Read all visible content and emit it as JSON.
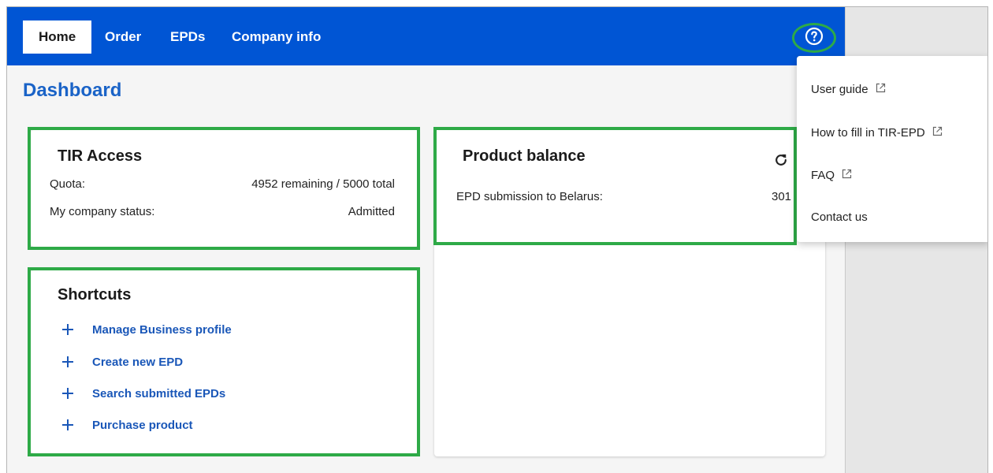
{
  "nav": {
    "tabs": [
      {
        "label": "Home"
      },
      {
        "label": "Order"
      },
      {
        "label": "EPDs"
      },
      {
        "label": "Company info"
      }
    ],
    "help_icon": "help-circle-icon"
  },
  "page": {
    "title": "Dashboard"
  },
  "tir_access": {
    "title": "TIR Access",
    "rows": [
      {
        "label": "Quota:",
        "value": "4952 remaining / 5000 total"
      },
      {
        "label": "My company status:",
        "value": "Admitted"
      }
    ]
  },
  "product_balance": {
    "title": "Product balance",
    "refresh_icon": "refresh-icon",
    "rows": [
      {
        "label": "EPD submission to Belarus:",
        "value": "301"
      }
    ]
  },
  "shortcuts": {
    "title": "Shortcuts",
    "items": [
      {
        "label": "Manage Business profile"
      },
      {
        "label": "Create new EPD"
      },
      {
        "label": "Search submitted EPDs"
      },
      {
        "label": "Purchase product"
      }
    ]
  },
  "help_menu": {
    "items": [
      {
        "label": "User guide",
        "external": true
      },
      {
        "label": "How to fill in TIR-EPD",
        "external": true
      },
      {
        "label": "FAQ",
        "external": true
      },
      {
        "label": "Contact us",
        "external": false
      }
    ]
  },
  "colors": {
    "topbar": "#0055d4",
    "link": "#1a57b8",
    "title": "#1a63c7",
    "highlight": "#2eaa47"
  }
}
